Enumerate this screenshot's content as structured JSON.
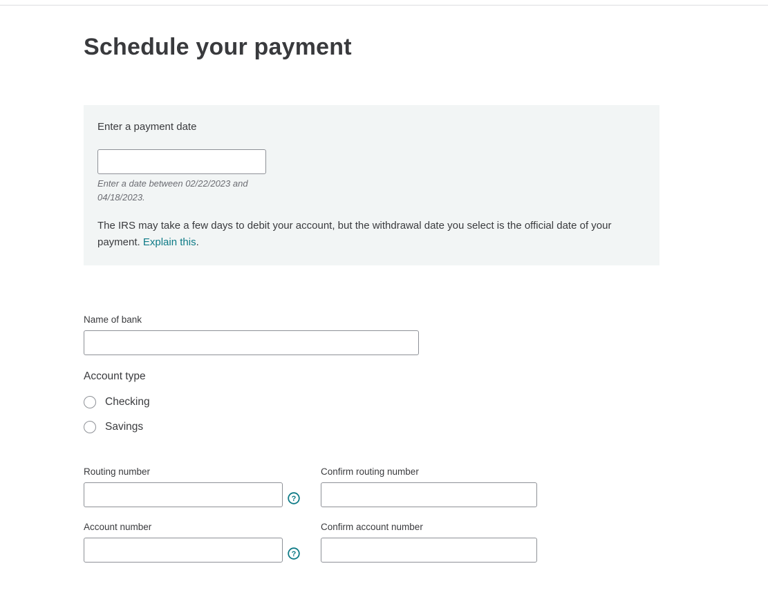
{
  "page": {
    "title": "Schedule your payment"
  },
  "payment_date": {
    "label": "Enter a payment date",
    "value": "",
    "placeholder": "",
    "hint": "Enter a date between 02/22/2023 and 04/18/2023.",
    "note": "The IRS may take a few days to debit your account, but the withdrawal date you select is the official date of your payment.",
    "link_text": "Explain this",
    "link_suffix": "."
  },
  "bank": {
    "name_label": "Name of bank",
    "name_value": ""
  },
  "account_type": {
    "label": "Account type",
    "options": [
      {
        "label": "Checking",
        "selected": false
      },
      {
        "label": "Savings",
        "selected": false
      }
    ]
  },
  "routing": {
    "label": "Routing number",
    "value": "",
    "confirm_label": "Confirm routing number",
    "confirm_value": "",
    "help_icon": "question-circle-icon"
  },
  "account": {
    "label": "Account number",
    "value": "",
    "confirm_label": "Confirm account number",
    "confirm_value": "",
    "help_icon": "question-circle-icon"
  },
  "colors": {
    "link": "#0d7a86",
    "panel_background": "#f2f5f5",
    "text": "#393a3d",
    "input_border": "#8d9096"
  }
}
